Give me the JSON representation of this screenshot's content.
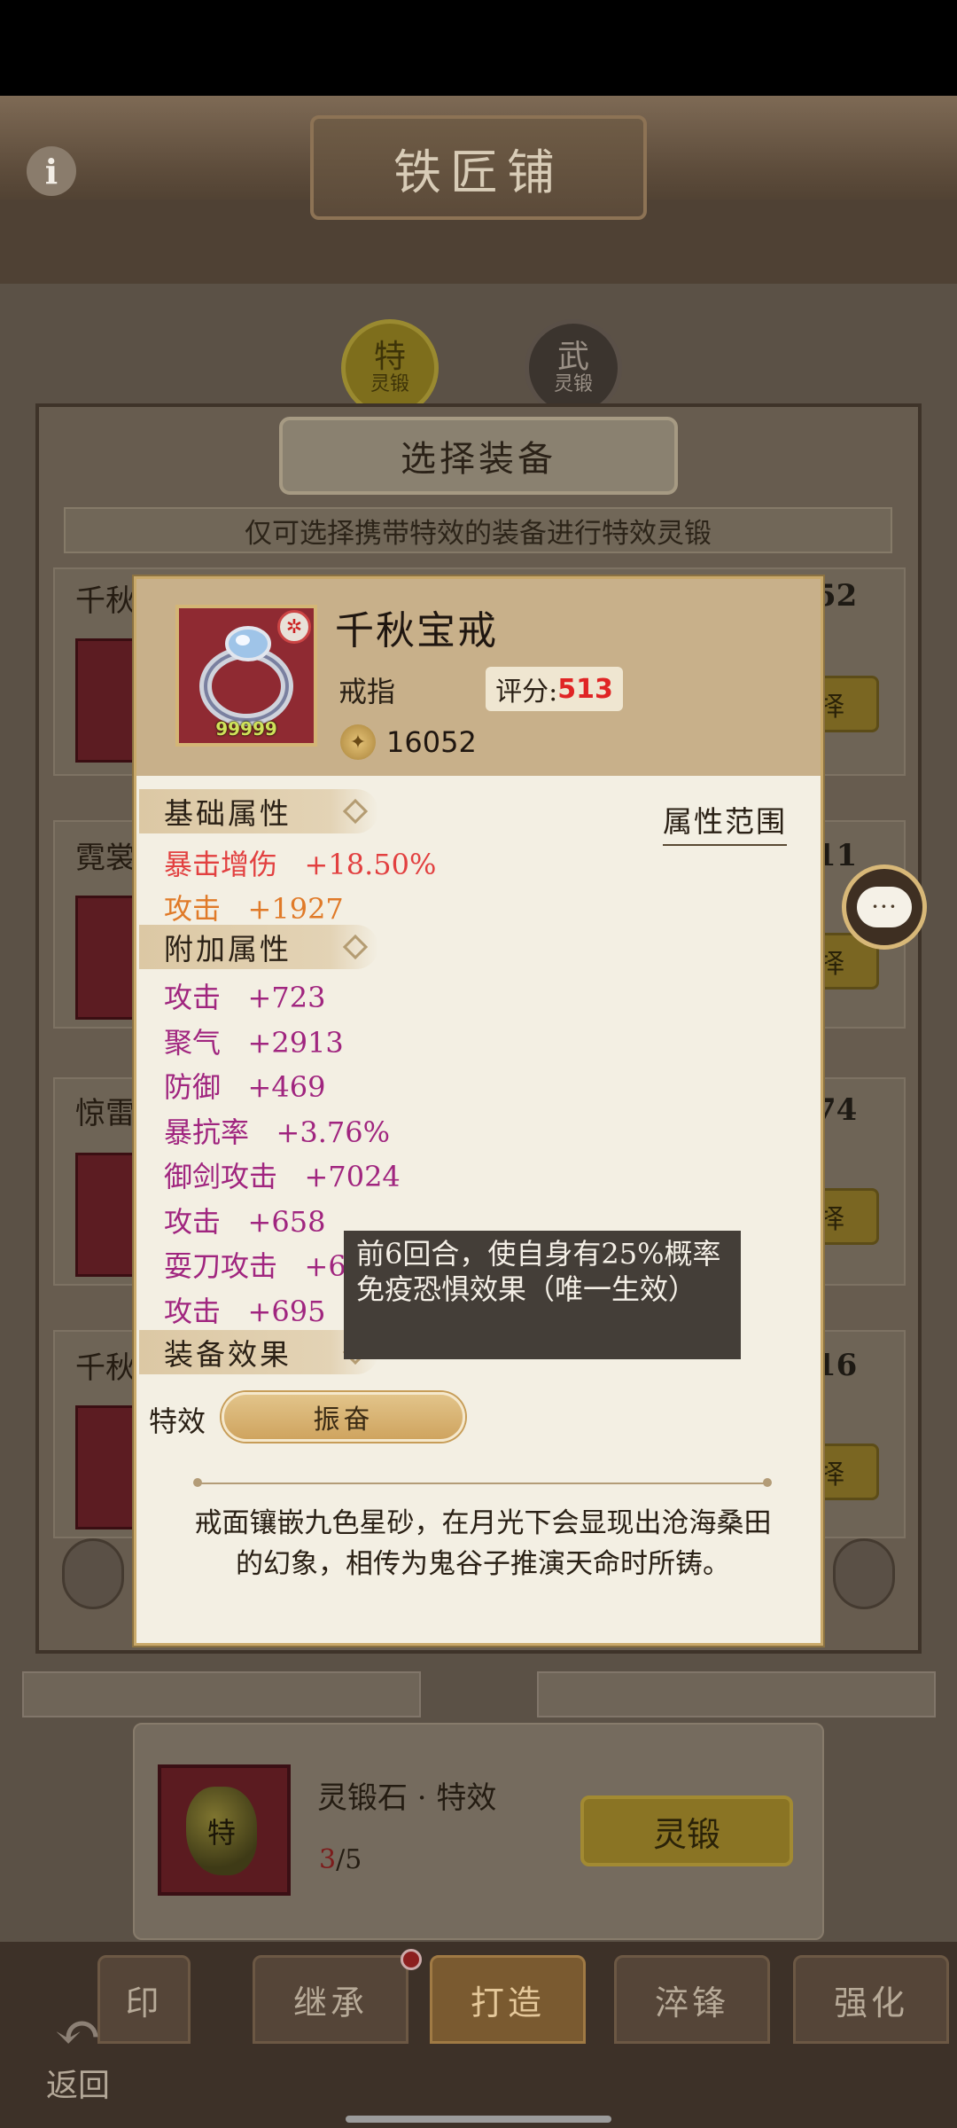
{
  "header": {
    "title": "铁匠铺",
    "info_icon": "info-icon",
    "info_label": "i"
  },
  "mode_tabs": [
    {
      "top": "特",
      "bottom": "灵锻",
      "active": true
    },
    {
      "top": "武",
      "bottom": "灵锻",
      "active": false
    }
  ],
  "dialog": {
    "title": "选择装备",
    "hint": "仅可选择携带特效的装备进行特效灵锻",
    "rows": [
      {
        "name": "千秋",
        "score": "52",
        "button": "择"
      },
      {
        "name": "霓裳",
        "score": "11",
        "button": "择"
      },
      {
        "name": "惊雷",
        "score": "74",
        "button": "择"
      },
      {
        "name": "千秋",
        "score": "16",
        "button": "择"
      }
    ]
  },
  "item": {
    "name": "千秋宝戒",
    "type": "戒指",
    "score_label": "评分:",
    "score_value": "513",
    "power": "16052",
    "level": "99999",
    "badge": "✲"
  },
  "sections": {
    "basic": "基础属性",
    "extra": "附加属性",
    "effect": "装备效果",
    "range_link": "属性范围"
  },
  "basic_attrs": [
    {
      "name": "暴击增伤",
      "value": "+18.50%",
      "color": "#e24040"
    },
    {
      "name": "攻击",
      "value": "+1927",
      "color": "#e07a28"
    }
  ],
  "extra_attrs": [
    {
      "name": "攻击",
      "value": "+723"
    },
    {
      "name": "聚气",
      "value": "+2913"
    },
    {
      "name": "防御",
      "value": "+469"
    },
    {
      "name": "暴抗率",
      "value": "+3.76%"
    },
    {
      "name": "御剑攻击",
      "value": "+7024"
    },
    {
      "name": "攻击",
      "value": "+658"
    },
    {
      "name": "耍刀攻击",
      "value": "+6"
    },
    {
      "name": "攻击",
      "value": "+695"
    }
  ],
  "tooltip": "前6回合，使自身有25%概率免疫恐惧效果（唯一生效）",
  "effect": {
    "label": "特效",
    "value": "振奋"
  },
  "description": "戒面镶嵌九色星砂，在月光下会显现出沧海桑田的幻象，相传为鬼谷子推演天命时所铸。",
  "chat": {
    "icon": "chat-bubble-icon",
    "dots": "···"
  },
  "reforge": {
    "stone_name": "灵锻石 · 特效",
    "stone_glyph": "特",
    "count_current": "3",
    "count_total": "/5",
    "button": "灵锻"
  },
  "bottom_nav": {
    "tabs": [
      "印",
      "继承",
      "打造",
      "淬锋",
      "强化"
    ],
    "active": "打造",
    "back": "返回",
    "back_icon": "back-arrow-icon",
    "back_glyph": "↶"
  },
  "colors": {
    "accent_red": "#e24040",
    "accent_orange": "#e07a28",
    "attr_purple": "#a0257f",
    "gold": "#cfa45f"
  }
}
